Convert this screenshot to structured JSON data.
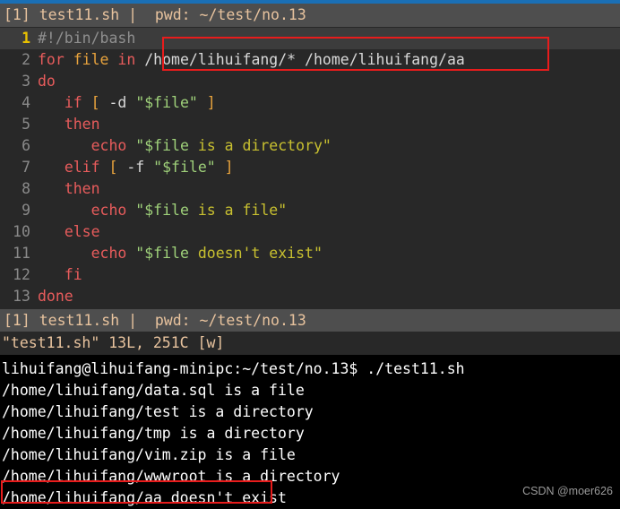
{
  "editor": {
    "tabline": "[1] test11.sh |  pwd: ~/test/no.13",
    "statusline": "[1] test11.sh |  pwd: ~/test/no.13",
    "cmdline": "\"test11.sh\" 13L, 251C [w]",
    "tilde": "~",
    "lines": [
      {
        "num": "1",
        "segments": [
          {
            "text": "#!/bin/bash",
            "cls": "c-comment"
          }
        ]
      },
      {
        "num": "2",
        "segments": [
          {
            "text": "for ",
            "cls": "c-keyword"
          },
          {
            "text": "file ",
            "cls": "c-builtin"
          },
          {
            "text": "in ",
            "cls": "c-keyword"
          },
          {
            "text": "/home/lihuifang/* /home/lihuifang/aa",
            "cls": "c-plain"
          }
        ]
      },
      {
        "num": "3",
        "segments": [
          {
            "text": "do",
            "cls": "c-keyword"
          }
        ]
      },
      {
        "num": "4",
        "segments": [
          {
            "text": "   ",
            "cls": "c-plain"
          },
          {
            "text": "if ",
            "cls": "c-keyword"
          },
          {
            "text": "[ ",
            "cls": "c-builtin"
          },
          {
            "text": "-d ",
            "cls": "c-plain"
          },
          {
            "text": "\"$file\"",
            "cls": "c-string"
          },
          {
            "text": " ",
            "cls": "c-plain"
          },
          {
            "text": "]",
            "cls": "c-builtin"
          }
        ]
      },
      {
        "num": "5",
        "segments": [
          {
            "text": "   ",
            "cls": "c-plain"
          },
          {
            "text": "then",
            "cls": "c-keyword"
          }
        ]
      },
      {
        "num": "6",
        "segments": [
          {
            "text": "      ",
            "cls": "c-plain"
          },
          {
            "text": "echo ",
            "cls": "c-keyword"
          },
          {
            "text": "\"$file ",
            "cls": "c-string"
          },
          {
            "text": "is a directory\"",
            "cls": "c-strwarn"
          }
        ]
      },
      {
        "num": "7",
        "segments": [
          {
            "text": "   ",
            "cls": "c-plain"
          },
          {
            "text": "elif ",
            "cls": "c-keyword"
          },
          {
            "text": "[ ",
            "cls": "c-builtin"
          },
          {
            "text": "-f ",
            "cls": "c-plain"
          },
          {
            "text": "\"$file\"",
            "cls": "c-string"
          },
          {
            "text": " ",
            "cls": "c-plain"
          },
          {
            "text": "]",
            "cls": "c-builtin"
          }
        ]
      },
      {
        "num": "8",
        "segments": [
          {
            "text": "   ",
            "cls": "c-plain"
          },
          {
            "text": "then",
            "cls": "c-keyword"
          }
        ]
      },
      {
        "num": "9",
        "segments": [
          {
            "text": "      ",
            "cls": "c-plain"
          },
          {
            "text": "echo ",
            "cls": "c-keyword"
          },
          {
            "text": "\"$file ",
            "cls": "c-string"
          },
          {
            "text": "is a file\"",
            "cls": "c-strwarn"
          }
        ]
      },
      {
        "num": "10",
        "segments": [
          {
            "text": "   ",
            "cls": "c-plain"
          },
          {
            "text": "else",
            "cls": "c-keyword"
          }
        ]
      },
      {
        "num": "11",
        "segments": [
          {
            "text": "      ",
            "cls": "c-plain"
          },
          {
            "text": "echo ",
            "cls": "c-keyword"
          },
          {
            "text": "\"$file ",
            "cls": "c-string"
          },
          {
            "text": "doesn't exist\"",
            "cls": "c-strwarn"
          }
        ]
      },
      {
        "num": "12",
        "segments": [
          {
            "text": "   ",
            "cls": "c-plain"
          },
          {
            "text": "fi",
            "cls": "c-keyword"
          }
        ]
      },
      {
        "num": "13",
        "segments": [
          {
            "text": "done",
            "cls": "c-keyword"
          }
        ]
      }
    ],
    "cursor_line_index": 0
  },
  "terminal": {
    "lines": [
      "lihuifang@lihuifang-minipc:~/test/no.13$ ./test11.sh",
      "/home/lihuifang/data.sql is a file",
      "/home/lihuifang/test is a directory",
      "/home/lihuifang/tmp is a directory",
      "/home/lihuifang/vim.zip is a file",
      "/home/lihuifang/wwwroot is a directory",
      "/home/lihuifang/aa doesn't exist"
    ]
  },
  "annotations": {
    "highlight_color": "#e81c1c",
    "box_for_loop_target": "/home/lihuifang/* /home/lihuifang/aa",
    "box_output_target": "/home/lihuifang/aa doesn't exist"
  },
  "watermark": {
    "text": "CSDN @moer626"
  }
}
